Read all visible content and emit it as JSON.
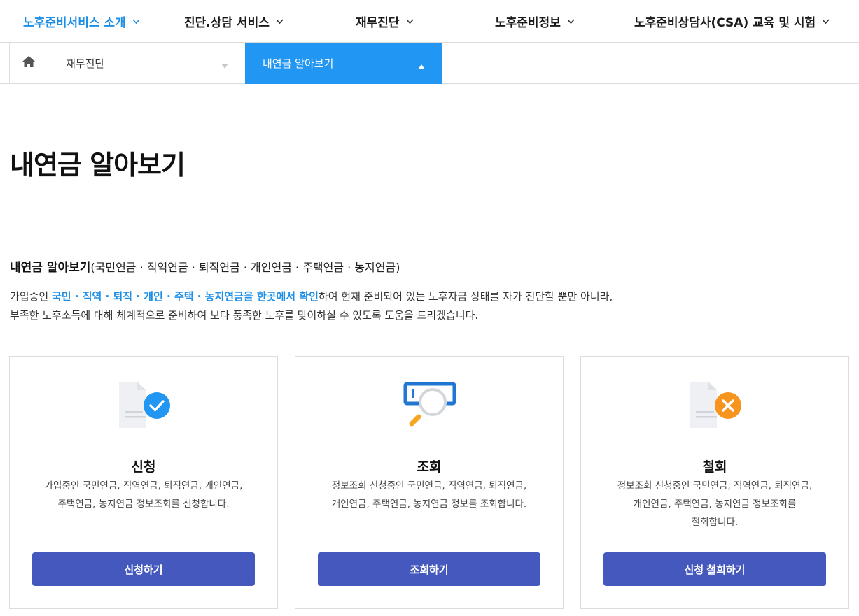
{
  "nav": {
    "items": [
      {
        "label": "노후준비서비스 소개"
      },
      {
        "label": "진단.상담 서비스"
      },
      {
        "label": "재무진단"
      },
      {
        "label": "노후준비정보"
      },
      {
        "label": "노후준비상담사(CSA) 교육 및 시험"
      }
    ]
  },
  "breadcrumb": {
    "level1": "재무진단",
    "level2": "내연금 알아보기"
  },
  "page": {
    "title": "내연금 알아보기"
  },
  "intro": {
    "head_bold": "내연금 알아보기",
    "head_rest": "(국민연금 · 직역연금 · 퇴직연금 · 개인연금 · 주택연금 · 농지연금)",
    "line1_pre": "가입중인 ",
    "line1_highlight": "국민 · 직역 · 퇴직 · 개인 · 주택 · 농지연금을 한곳에서 확인",
    "line1_post": "하여 현재 준비되어 있는 노후자금 상태를 자가 진단할 뿐만 아니라,",
    "line2": "부족한 노후소득에 대해 체계적으로 준비하여 보다 풍족한 노후를 맞이하실 수 있도록 도움을 드리겠습니다."
  },
  "cards": [
    {
      "title": "신청",
      "desc1": "가입중인 국민연금, 직역연금, 퇴직연금, 개인연금,",
      "desc2": "주택연금, 농지연금 정보조회를 신청합니다.",
      "desc3": "",
      "button": "신청하기",
      "icon": "document-check-icon"
    },
    {
      "title": "조회",
      "desc1": "정보조회 신청중인 국민연금, 직역연금, 퇴직연금,",
      "desc2": "개인연금, 주택연금, 농지연금 정보를 조회합니다.",
      "desc3": "",
      "button": "조회하기",
      "icon": "search-magnifier-icon"
    },
    {
      "title": "철회",
      "desc1": "정보조회 신청중인 국민연금, 직역연금, 퇴직연금,",
      "desc2": "개인연금, 주택연금, 농지연금 정보조회를",
      "desc3": "철회합니다.",
      "button": "신청 철회하기",
      "icon": "document-cancel-icon"
    }
  ],
  "colors": {
    "accent": "#1e8fe6",
    "breadcrumb_active": "#2196f3",
    "button": "#4458bd",
    "check_badge": "#2196f3",
    "cancel_badge": "#f7941d"
  }
}
